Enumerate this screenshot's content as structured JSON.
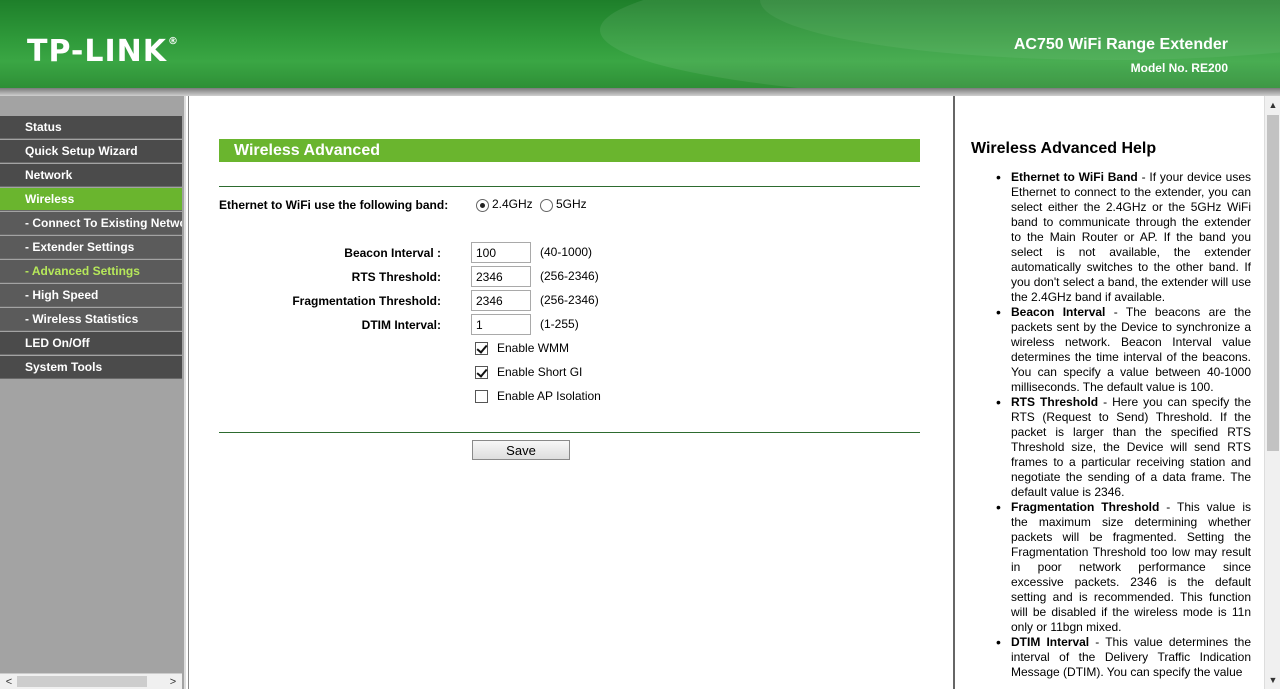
{
  "header": {
    "logo": "TP-LINK",
    "logo_mark": "®",
    "product": "AC750 WiFi Range Extender",
    "model": "Model No. RE200"
  },
  "sidebar": {
    "items": [
      {
        "label": "Status"
      },
      {
        "label": "Quick Setup Wizard"
      },
      {
        "label": "Network"
      },
      {
        "label": "Wireless"
      },
      {
        "label": "- Connect To Existing Network"
      },
      {
        "label": "- Extender Settings"
      },
      {
        "label": "- Advanced Settings"
      },
      {
        "label": "- High Speed"
      },
      {
        "label": "- Wireless Statistics"
      },
      {
        "label": "LED On/Off"
      },
      {
        "label": "System Tools"
      }
    ],
    "active_section": "Wireless",
    "selected_subitem": "- Advanced Settings",
    "scroll_left_icon": "<",
    "scroll_right_icon": ">"
  },
  "main": {
    "title": "Wireless Advanced",
    "band": {
      "label": "Ethernet to WiFi use the following band:",
      "options": [
        "2.4GHz",
        "5GHz"
      ],
      "selected": "2.4GHz"
    },
    "fields": [
      {
        "label": "Beacon Interval :",
        "value": "100",
        "range": "(40-1000)"
      },
      {
        "label": "RTS Threshold:",
        "value": "2346",
        "range": "(256-2346)"
      },
      {
        "label": "Fragmentation Threshold:",
        "value": "2346",
        "range": "(256-2346)"
      },
      {
        "label": "DTIM Interval:",
        "value": "1",
        "range": "(1-255)"
      }
    ],
    "checkboxes": [
      {
        "label": "Enable WMM",
        "checked": true
      },
      {
        "label": "Enable Short GI",
        "checked": true
      },
      {
        "label": "Enable AP Isolation",
        "checked": false
      }
    ],
    "save_label": "Save"
  },
  "help": {
    "title": "Wireless Advanced Help",
    "items": [
      {
        "term": "Ethernet to WiFi Band",
        "text": " - If your device uses Ethernet to connect to the extender, you can select either the 2.4GHz or the 5GHz WiFi band to communicate through the extender to the Main Router or AP. If the band you select is not available, the extender automatically switches to the other band. If you don't select a band, the extender will use the 2.4GHz band if available."
      },
      {
        "term": "Beacon Interval",
        "text": " - The beacons are the packets sent by the Device to synchronize a wireless network. Beacon Interval value determines the time interval of the beacons. You can specify a value between 40-1000 milliseconds. The default value is 100."
      },
      {
        "term": "RTS Threshold",
        "text": " - Here you can specify the RTS (Request to Send) Threshold. If the packet is larger than the specified RTS Threshold size, the Device will send RTS frames to a particular receiving station and negotiate the sending of a data frame. The default value is 2346."
      },
      {
        "term": "Fragmentation Threshold",
        "text": " - This value is the maximum size determining whether packets will be fragmented. Setting the Fragmentation Threshold too low may result in poor network performance since excessive packets. 2346 is the default setting and is recommended. This function will be disabled if the wireless mode is 11n only or 11bgn mixed."
      },
      {
        "term": "DTIM Interval",
        "text": " - This value determines the interval of the Delivery Traffic Indication Message (DTIM). You can specify the value"
      }
    ]
  },
  "scrollbar": {
    "up_icon": "▲",
    "down_icon": "▼"
  }
}
